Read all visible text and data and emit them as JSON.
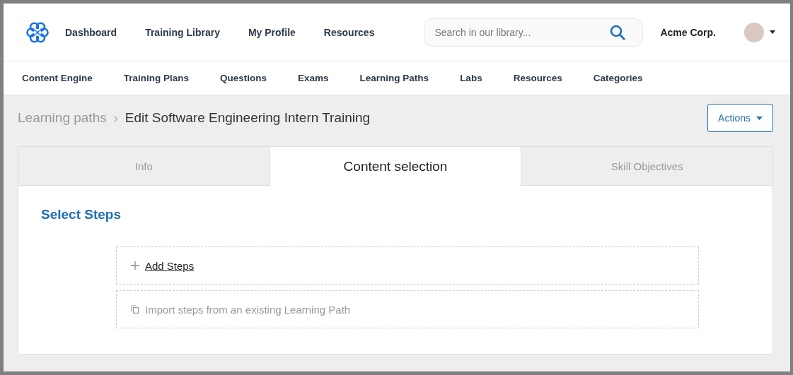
{
  "header": {
    "nav": [
      {
        "label": "Dashboard"
      },
      {
        "label": "Training Library"
      },
      {
        "label": "My Profile"
      },
      {
        "label": "Resources"
      }
    ],
    "search": {
      "placeholder": "Search in our library..."
    },
    "company": "Acme Corp."
  },
  "subnav": [
    {
      "label": "Content Engine"
    },
    {
      "label": "Training Plans"
    },
    {
      "label": "Questions"
    },
    {
      "label": "Exams"
    },
    {
      "label": "Learning Paths"
    },
    {
      "label": "Labs"
    },
    {
      "label": "Resources"
    },
    {
      "label": "Categories"
    }
  ],
  "breadcrumb": {
    "parent": "Learning paths",
    "separator": "›",
    "current": "Edit Software Engineering Intern Training"
  },
  "actions_button": "Actions",
  "tabs": [
    {
      "label": "Info",
      "selected": false
    },
    {
      "label": "Content selection",
      "selected": true
    },
    {
      "label": "Skill Objectives",
      "selected": false
    }
  ],
  "section_title": "Select Steps",
  "step_options": [
    {
      "kind": "add",
      "label": "Add Steps",
      "disabled": false
    },
    {
      "kind": "import",
      "label": "Import steps from an existing Learning Path",
      "disabled": true
    }
  ]
}
